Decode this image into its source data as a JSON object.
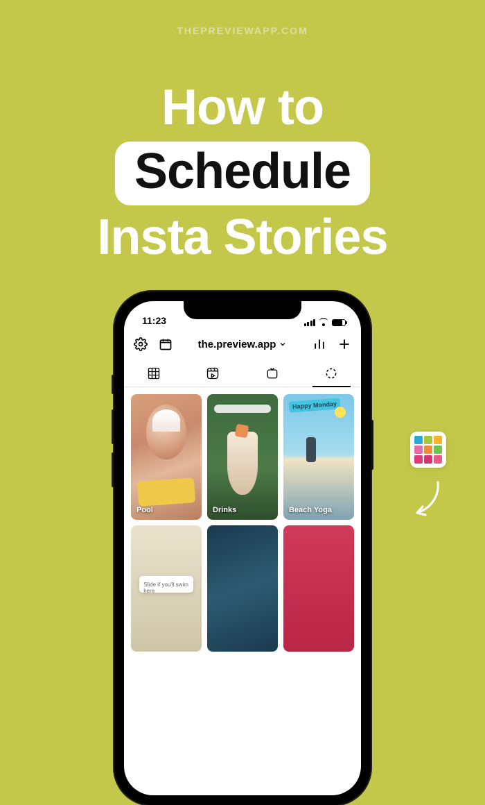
{
  "watermark": "THEPREVIEWAPP.COM",
  "hero": {
    "line1": "How to",
    "highlight": "Schedule",
    "line3": "Insta Stories"
  },
  "statusbar": {
    "time": "11:23"
  },
  "topbar": {
    "account": "the.preview.app"
  },
  "stories": [
    {
      "label": "Pool"
    },
    {
      "label": "Drinks"
    },
    {
      "label": "Beach Yoga",
      "badge": "Happy Monday"
    },
    {
      "label": "",
      "slide_text": "Slide if you'll swim here"
    },
    {
      "label": ""
    },
    {
      "label": ""
    }
  ],
  "badge_colors": [
    "#2aa8d8",
    "#a4c93a",
    "#f2b22a",
    "#e86aa6",
    "#f08a3c",
    "#6fc24a",
    "#e03a7a",
    "#d4356e",
    "#e85a8a"
  ]
}
